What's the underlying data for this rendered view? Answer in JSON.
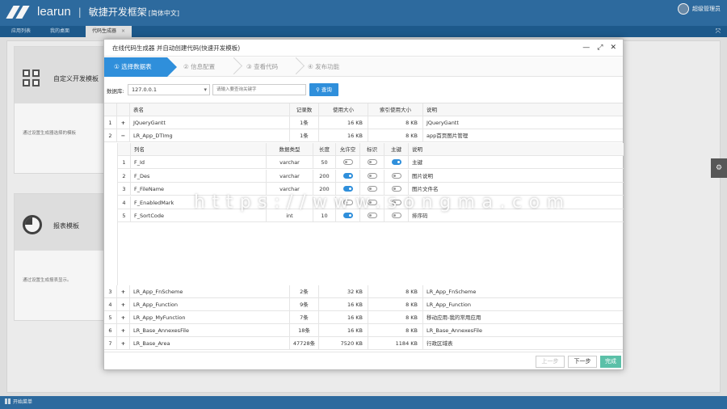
{
  "app": {
    "brand": "learun",
    "separator": "|",
    "subtitle": "敏捷开发框架",
    "language": "[简体中文]",
    "user": "超级管理员"
  },
  "tabs": [
    {
      "label": "应用列表"
    },
    {
      "label": "我的桌面"
    },
    {
      "label": "代码生成器",
      "close": "×"
    }
  ],
  "background": {
    "card1": {
      "title": "自定义开发模板",
      "desc": "通过设置生成器选择的模板"
    },
    "card2": {
      "title": "报表模板",
      "desc": "通过设置生成报表显示。"
    }
  },
  "statusbar": {
    "start_label": "开始菜单"
  },
  "dialog": {
    "title": "在线代码生成器 并自动创建代码(快速开发模板)",
    "controls": {
      "minimize": "—",
      "maximize": "⤢",
      "close": "✕"
    },
    "steps": [
      {
        "label": "① 选择数据表"
      },
      {
        "label": "② 信息配置"
      },
      {
        "label": "③ 查看代码"
      },
      {
        "label": "④ 发布功能"
      }
    ],
    "filter": {
      "db_label": "数据库:",
      "db_value": "127.0.0.1",
      "search_placeholder": "请输入要查询关键字",
      "search_button": "查询"
    },
    "columns": {
      "name": "表名",
      "rows": "记录数",
      "size": "使用大小",
      "index": "索引使用大小",
      "desc": "说明"
    },
    "tables_top": [
      {
        "no": "1",
        "sym": "+",
        "name": "JQueryGantt",
        "rows": "1条",
        "size": "16 KB",
        "index": "8 KB",
        "desc": "JQueryGantt"
      },
      {
        "no": "2",
        "sym": "−",
        "name": "LR_App_DTImg",
        "rows": "1条",
        "size": "16 KB",
        "index": "8 KB",
        "desc": "app首页图片管理"
      }
    ],
    "sub_columns": {
      "name": "列名",
      "type": "数据类型",
      "len": "长度",
      "nullable": "允许空",
      "identity": "标识",
      "pk": "主键",
      "desc": "说明"
    },
    "sub_rows": [
      {
        "no": "1",
        "name": "F_Id",
        "type": "varchar",
        "len": "50",
        "nullable": false,
        "identity": false,
        "pk": true,
        "desc": "主键"
      },
      {
        "no": "2",
        "name": "F_Des",
        "type": "varchar",
        "len": "200",
        "nullable": true,
        "identity": false,
        "pk": false,
        "desc": "图片说明"
      },
      {
        "no": "3",
        "name": "F_FileName",
        "type": "varchar",
        "len": "200",
        "nullable": true,
        "identity": false,
        "pk": false,
        "desc": "图片文件名"
      },
      {
        "no": "4",
        "name": "F_EnabledMark",
        "type": "",
        "len": "",
        "nullable": false,
        "identity": false,
        "pk": false,
        "desc": ""
      },
      {
        "no": "5",
        "name": "F_SortCode",
        "type": "int",
        "len": "10",
        "nullable": true,
        "identity": false,
        "pk": false,
        "desc": "排序码"
      }
    ],
    "tables_bottom": [
      {
        "no": "3",
        "sym": "+",
        "name": "LR_App_FnScheme",
        "rows": "2条",
        "size": "32 KB",
        "index": "8 KB",
        "desc": "LR_App_FnScheme"
      },
      {
        "no": "4",
        "sym": "+",
        "name": "LR_App_Function",
        "rows": "9条",
        "size": "16 KB",
        "index": "8 KB",
        "desc": "LR_App_Function"
      },
      {
        "no": "5",
        "sym": "+",
        "name": "LR_App_MyFunction",
        "rows": "7条",
        "size": "16 KB",
        "index": "8 KB",
        "desc": "移动应用-我的常用应用"
      },
      {
        "no": "6",
        "sym": "+",
        "name": "LR_Base_AnnexesFile",
        "rows": "18条",
        "size": "16 KB",
        "index": "8 KB",
        "desc": "LR_Base_AnnexesFile"
      },
      {
        "no": "7",
        "sym": "+",
        "name": "LR_Base_Area",
        "rows": "47728条",
        "size": "7520 KB",
        "index": "1184 KB",
        "desc": "行政区域表"
      }
    ],
    "footer": {
      "prev": "上一步",
      "next": "下一步",
      "finish": "完成"
    }
  },
  "watermark": "https://www.songma.com"
}
